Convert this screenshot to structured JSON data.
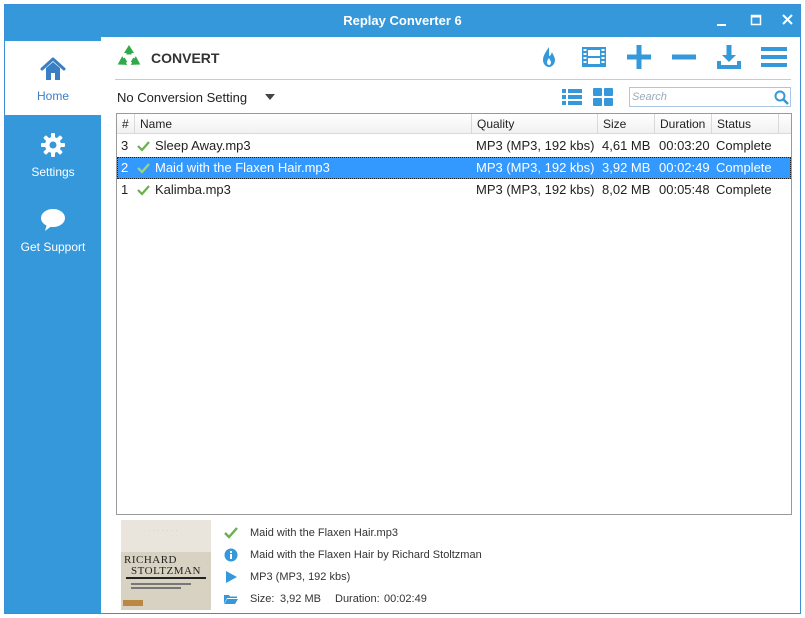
{
  "window": {
    "title": "Replay Converter 6"
  },
  "sidebar": {
    "items": [
      {
        "label": "Home",
        "icon": "home-icon",
        "active": true
      },
      {
        "label": "Settings",
        "icon": "gear-icon",
        "active": false
      },
      {
        "label": "Get Support",
        "icon": "chat-bubble-icon",
        "active": false
      }
    ]
  },
  "header": {
    "title": "CONVERT",
    "toolbar_icons": [
      "flame-icon",
      "film-icon",
      "add-icon",
      "remove-icon",
      "download-icon",
      "menu-icon"
    ]
  },
  "controls": {
    "conversion_setting": "No Conversion Setting",
    "search_placeholder": "Search"
  },
  "table": {
    "columns": [
      "#",
      "Name",
      "Quality",
      "Size",
      "Duration",
      "Status"
    ],
    "rows": [
      {
        "num": "3",
        "name": "Sleep Away.mp3",
        "quality": "MP3 (MP3, 192 kbs)",
        "size": "4,61 MB",
        "duration": "00:03:20",
        "status": "Complete",
        "selected": false
      },
      {
        "num": "2",
        "name": "Maid with the Flaxen Hair.mp3",
        "quality": "MP3 (MP3, 192 kbs)",
        "size": "3,92 MB",
        "duration": "00:02:49",
        "status": "Complete",
        "selected": true
      },
      {
        "num": "1",
        "name": "Kalimba.mp3",
        "quality": "MP3 (MP3, 192 kbs)",
        "size": "8,02 MB",
        "duration": "00:05:48",
        "status": "Complete",
        "selected": false
      }
    ]
  },
  "details": {
    "album_art": {
      "line1": "RICHARD",
      "line2": "STOLTZMAN"
    },
    "filename": "Maid with the Flaxen Hair.mp3",
    "info": "Maid with the Flaxen Hair by Richard Stoltzman",
    "format": "MP3 (MP3, 192 kbs)",
    "size_label": "Size:",
    "size_value": "3,92 MB",
    "duration_label": "Duration:",
    "duration_value": "00:02:49"
  },
  "colors": {
    "accent": "#3498db",
    "selection": "#3399ff",
    "check_green": "#6ab04c",
    "recycle_green": "#2eaa4a"
  }
}
